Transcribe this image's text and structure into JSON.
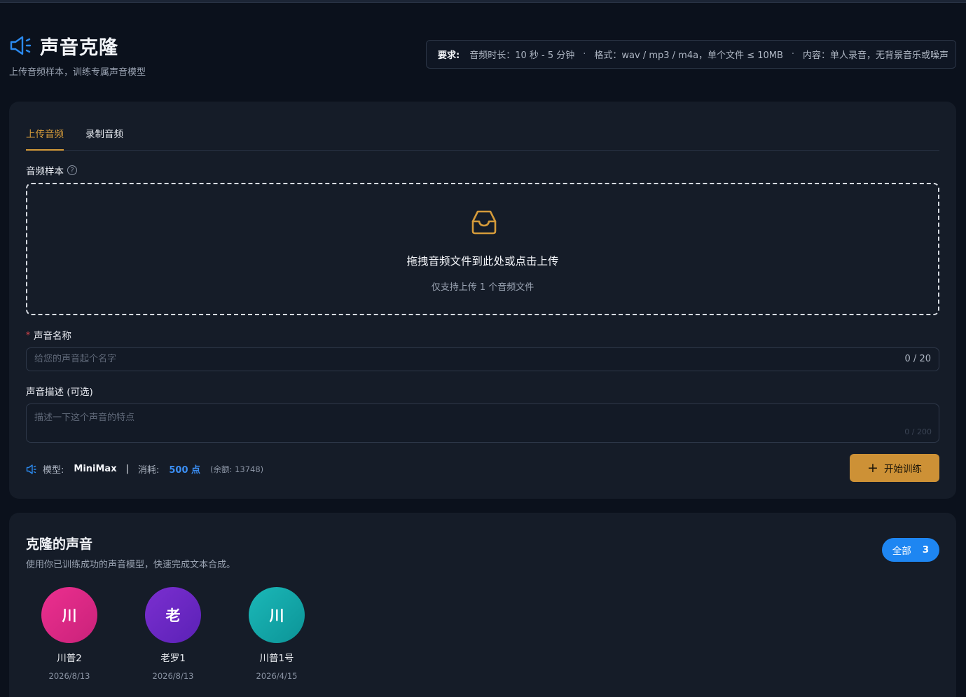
{
  "header": {
    "title": "声音克隆",
    "subtitle": "上传音频样本，训练专属声音模型",
    "requirements": {
      "label": "要求:",
      "duration": "音频时长：10 秒 - 5 分钟",
      "format": "格式：wav / mp3 / m4a，单个文件 ≤ 10MB",
      "content": "内容：单人录音，无背景音乐或噪声",
      "separator": "·"
    }
  },
  "tabs": [
    {
      "label": "上传音频",
      "active": true
    },
    {
      "label": "录制音频",
      "active": false
    }
  ],
  "upload": {
    "label": "音频样本",
    "help": "?",
    "title": "拖拽音频文件到此处或点击上传",
    "hint": "仅支持上传 1 个音频文件"
  },
  "name_field": {
    "required_mark": "*",
    "label": "声音名称",
    "value": "",
    "placeholder": "给您的声音起个名字",
    "count": "0 / 20"
  },
  "desc_field": {
    "label": "声音描述 (可选)",
    "value": "",
    "placeholder": "描述一下这个声音的特点",
    "count": "0 / 200"
  },
  "info": {
    "model_label": "模型:",
    "model_value": "MiniMax",
    "separator": "|",
    "cost_label": "消耗:",
    "cost_value": "500 点",
    "balance": "(余额: 13748)"
  },
  "train_button": {
    "icon": "+",
    "label": "开始训练"
  },
  "cloned": {
    "title": "克隆的声音",
    "subtitle": "使用你已训练成功的声音模型，快速完成文本合成。",
    "filter": {
      "label": "全部",
      "count": "3"
    },
    "voices": [
      {
        "initial": "川",
        "name": "川普2",
        "date": "2026/8/13",
        "color": "#e02a88"
      },
      {
        "initial": "老",
        "name": "老罗1",
        "date": "2026/8/13",
        "color": "#6b27c4"
      },
      {
        "initial": "川",
        "name": "川普1号",
        "date": "2026/4/15",
        "color": "#13a8a9"
      }
    ]
  },
  "colors": {
    "accent": "#cd9136",
    "primary_blue": "#1e86f2",
    "background": "#0b111c",
    "card": "#151c28"
  },
  "icons": {
    "title_icon": "speaker-icon",
    "upload_icon": "inbox-icon",
    "info_icon": "speaker-icon"
  }
}
